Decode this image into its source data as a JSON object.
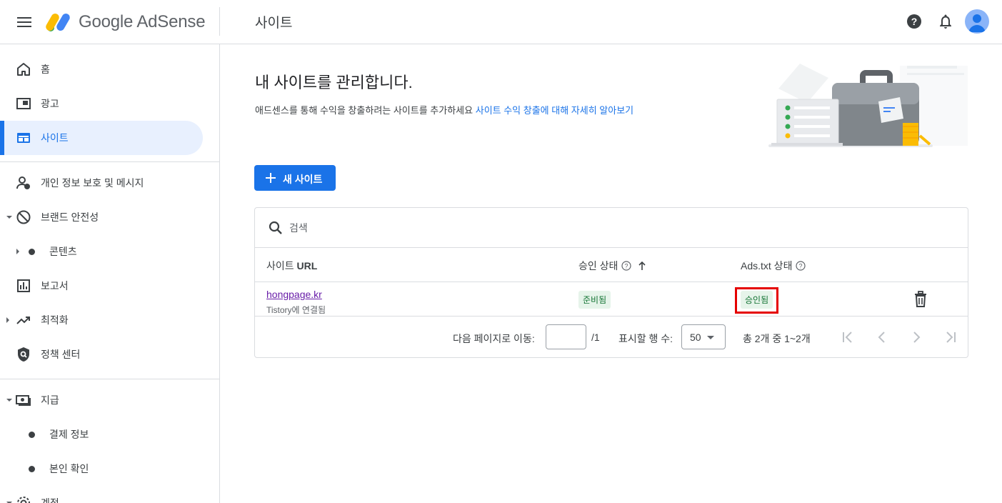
{
  "header": {
    "app_name": "Google AdSense",
    "page_title": "사이트"
  },
  "sidebar": {
    "items": [
      {
        "label": "홈",
        "icon": "home-icon"
      },
      {
        "label": "광고",
        "icon": "ads-icon"
      },
      {
        "label": "사이트",
        "icon": "sites-icon",
        "active": true
      },
      {
        "label": "개인 정보 보호 및 메시지",
        "icon": "privacy-messaging-icon"
      },
      {
        "label": "브랜드 안전성",
        "icon": "block-icon"
      },
      {
        "label": "콘텐츠"
      },
      {
        "label": "보고서",
        "icon": "reports-icon"
      },
      {
        "label": "최적화",
        "icon": "trending-up-icon"
      },
      {
        "label": "정책 센터",
        "icon": "policy-center-icon"
      },
      {
        "label": "지급",
        "icon": "payments-icon"
      },
      {
        "label": "결제 정보"
      },
      {
        "label": "본인 확인"
      },
      {
        "label": "계정",
        "icon": "gear-icon"
      }
    ]
  },
  "main": {
    "title": "내 사이트를 관리합니다.",
    "subtitle_text": "애드센스를 통해 수익을 창출하려는 사이트를 추가하세요",
    "subtitle_link": "사이트 수익 창출에 대해 자세히 알아보기",
    "new_site_button": "새 사이트",
    "search_placeholder": "검색",
    "table": {
      "col_site_prefix": "사이트",
      "col_site_suffix": "URL",
      "col_approval": "승인 상태",
      "col_adstxt": "Ads.txt 상태",
      "rows": [
        {
          "url": "hongpage.kr",
          "sub": "Tistory에 연결됨",
          "approval": "준비됨",
          "adstxt": "승인됨"
        }
      ]
    },
    "pagination": {
      "goto_label": "다음 페이지로 이동:",
      "page_input": "",
      "total_pages": "/1",
      "rows_label": "표시할 행 수:",
      "rows_value": "50",
      "range": "총 2개 중 1~2개"
    }
  },
  "colors": {
    "accent": "#1a73e8",
    "active_bg": "#e8f0fe",
    "badge_bg": "#e6f4ea",
    "badge_text": "#137333",
    "highlight": "#e50000",
    "link_visited": "#681da8"
  }
}
